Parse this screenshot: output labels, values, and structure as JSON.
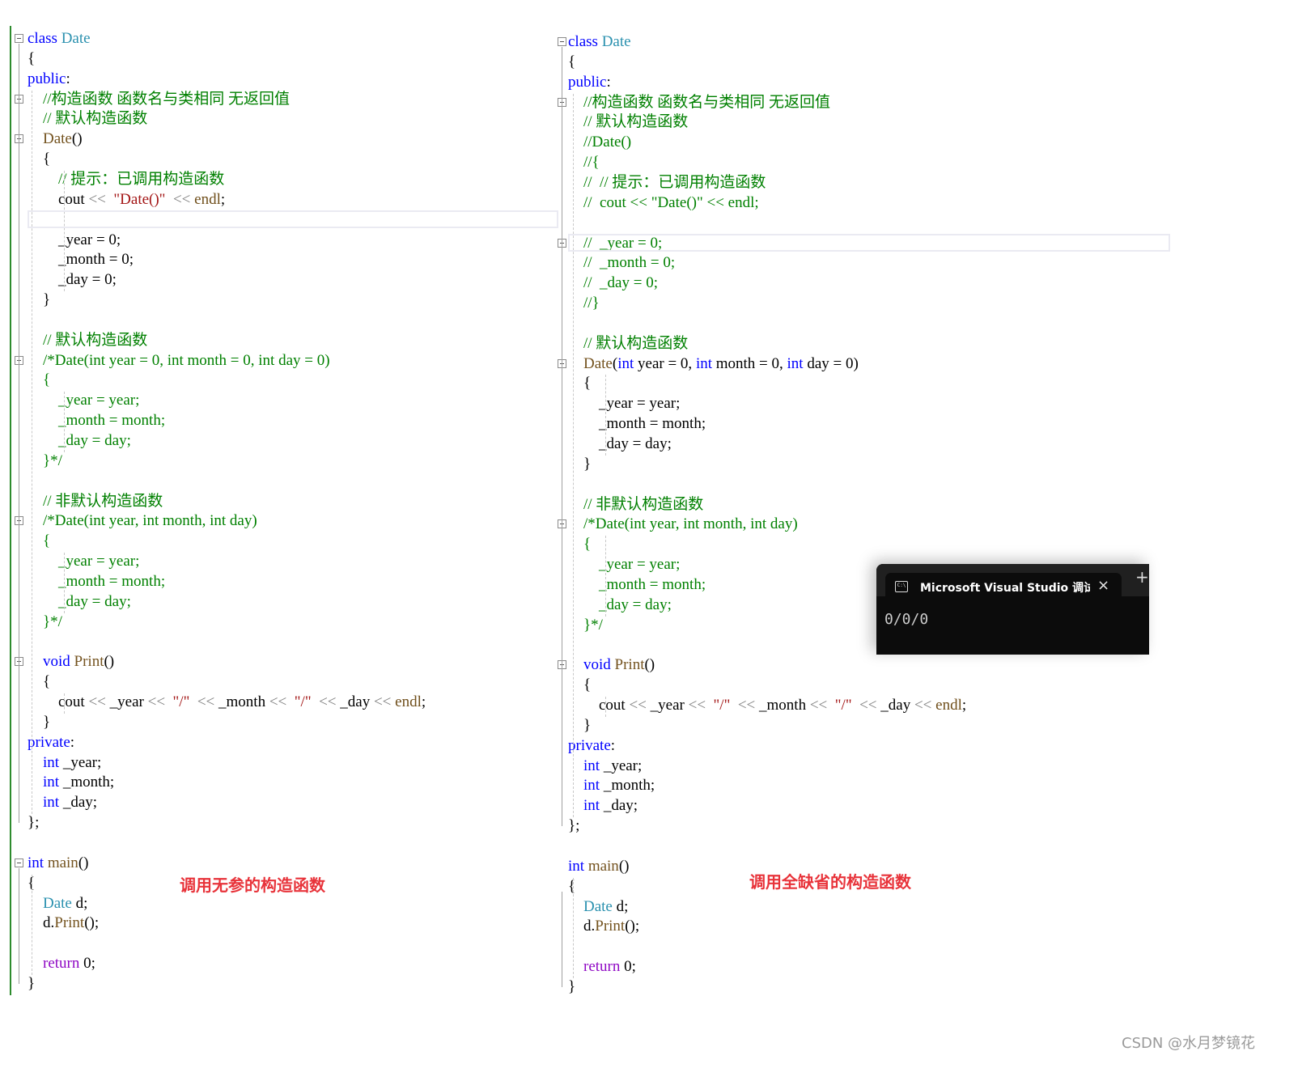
{
  "left_panel": {
    "caption": "调用无参的构造函数",
    "lines": [
      [
        [
          "kw",
          "class "
        ],
        [
          "ty",
          "Date"
        ]
      ],
      [
        [
          "",
          "{"
        ]
      ],
      [
        [
          "kw",
          "public"
        ],
        [
          "",
          ":"
        ]
      ],
      [
        [
          "",
          "    "
        ],
        [
          "cm",
          "//构造函数 函数名与类相同 无返回值"
        ]
      ],
      [
        [
          "",
          "    "
        ],
        [
          "cm",
          "// 默认构造函数"
        ]
      ],
      [
        [
          "",
          "    "
        ],
        [
          "fn",
          "Date"
        ],
        [
          "",
          "()"
        ]
      ],
      [
        [
          "",
          "    {"
        ]
      ],
      [
        [
          "",
          "        "
        ],
        [
          "cm",
          "// 提示：已调用构造函数"
        ]
      ],
      [
        [
          "",
          "        cout "
        ],
        [
          "op",
          "<<"
        ],
        [
          "",
          "  "
        ],
        [
          "st",
          "\"Date()\""
        ],
        [
          "",
          "  "
        ],
        [
          "op",
          "<<"
        ],
        [
          "ed",
          " endl"
        ],
        [
          "",
          ";"
        ]
      ],
      [
        [
          "",
          ""
        ]
      ],
      [
        [
          "",
          "        _year = 0;"
        ]
      ],
      [
        [
          "",
          "        _month = 0;"
        ]
      ],
      [
        [
          "",
          "        _day = 0;"
        ]
      ],
      [
        [
          "",
          "    }"
        ]
      ],
      [
        [
          "",
          ""
        ]
      ],
      [
        [
          "",
          "    "
        ],
        [
          "cm",
          "// 默认构造函数"
        ]
      ],
      [
        [
          "",
          "    "
        ],
        [
          "cm",
          "/*Date(int year = 0, int month = 0, int day = 0)"
        ]
      ],
      [
        [
          "",
          "    "
        ],
        [
          "cm",
          "{"
        ]
      ],
      [
        [
          "",
          "        "
        ],
        [
          "cm",
          "_year = year;"
        ]
      ],
      [
        [
          "",
          "        "
        ],
        [
          "cm",
          "_month = month;"
        ]
      ],
      [
        [
          "",
          "        "
        ],
        [
          "cm",
          "_day = day;"
        ]
      ],
      [
        [
          "",
          "    "
        ],
        [
          "cm",
          "}*/"
        ]
      ],
      [
        [
          "",
          ""
        ]
      ],
      [
        [
          "",
          "    "
        ],
        [
          "cm",
          "// 非默认构造函数"
        ]
      ],
      [
        [
          "",
          "    "
        ],
        [
          "cm",
          "/*Date(int year, int month, int day)"
        ]
      ],
      [
        [
          "",
          "    "
        ],
        [
          "cm",
          "{"
        ]
      ],
      [
        [
          "",
          "        "
        ],
        [
          "cm",
          "_year = year;"
        ]
      ],
      [
        [
          "",
          "        "
        ],
        [
          "cm",
          "_month = month;"
        ]
      ],
      [
        [
          "",
          "        "
        ],
        [
          "cm",
          "_day = day;"
        ]
      ],
      [
        [
          "",
          "    "
        ],
        [
          "cm",
          "}*/"
        ]
      ],
      [
        [
          "",
          ""
        ]
      ],
      [
        [
          "",
          "    "
        ],
        [
          "kw",
          "void "
        ],
        [
          "fn",
          "Print"
        ],
        [
          "",
          "()"
        ]
      ],
      [
        [
          "",
          "    {"
        ]
      ],
      [
        [
          "",
          "        cout "
        ],
        [
          "op",
          "<<"
        ],
        [
          "",
          " _year "
        ],
        [
          "op",
          "<<"
        ],
        [
          "",
          "  "
        ],
        [
          "st",
          "\"/\""
        ],
        [
          "",
          "  "
        ],
        [
          "op",
          "<<"
        ],
        [
          "",
          " _month "
        ],
        [
          "op",
          "<<"
        ],
        [
          "",
          "  "
        ],
        [
          "st",
          "\"/\""
        ],
        [
          "",
          "  "
        ],
        [
          "op",
          "<<"
        ],
        [
          "",
          " _day "
        ],
        [
          "op",
          "<<"
        ],
        [
          "ed",
          " endl"
        ],
        [
          "",
          ";"
        ]
      ],
      [
        [
          "",
          "    }"
        ]
      ],
      [
        [
          "kw",
          "private"
        ],
        [
          "",
          ":"
        ]
      ],
      [
        [
          "",
          "    "
        ],
        [
          "kw",
          "int"
        ],
        [
          "",
          " _year;"
        ]
      ],
      [
        [
          "",
          "    "
        ],
        [
          "kw",
          "int"
        ],
        [
          "",
          " _month;"
        ]
      ],
      [
        [
          "",
          "    "
        ],
        [
          "kw",
          "int"
        ],
        [
          "",
          " _day;"
        ]
      ],
      [
        [
          "",
          "};"
        ]
      ],
      [
        [
          "",
          ""
        ]
      ],
      [
        [
          "kw",
          "int "
        ],
        [
          "fn",
          "main"
        ],
        [
          "",
          "()"
        ]
      ],
      [
        [
          "",
          "{"
        ]
      ],
      [
        [
          "",
          "    "
        ],
        [
          "ty",
          "Date"
        ],
        [
          "",
          " d;"
        ]
      ],
      [
        [
          "",
          "    d."
        ],
        [
          "fn",
          "Print"
        ],
        [
          "",
          "();"
        ]
      ],
      [
        [
          "",
          ""
        ]
      ],
      [
        [
          "",
          "    "
        ],
        [
          "rt",
          "return"
        ],
        [
          "",
          " 0;"
        ]
      ],
      [
        [
          "",
          "}"
        ]
      ]
    ]
  },
  "right_panel": {
    "caption": "调用全缺省的构造函数",
    "lines": [
      [
        [
          "kw",
          "class "
        ],
        [
          "ty",
          "Date"
        ]
      ],
      [
        [
          "",
          "{"
        ]
      ],
      [
        [
          "kw",
          "public"
        ],
        [
          "",
          ":"
        ]
      ],
      [
        [
          "",
          "    "
        ],
        [
          "cm",
          "//构造函数 函数名与类相同 无返回值"
        ]
      ],
      [
        [
          "",
          "    "
        ],
        [
          "cm",
          "// 默认构造函数"
        ]
      ],
      [
        [
          "",
          "    "
        ],
        [
          "cm",
          "//Date()"
        ]
      ],
      [
        [
          "",
          "    "
        ],
        [
          "cm",
          "//{"
        ]
      ],
      [
        [
          "",
          "    "
        ],
        [
          "cm",
          "//  // 提示：已调用构造函数"
        ]
      ],
      [
        [
          "",
          "    "
        ],
        [
          "cm",
          "//  cout << \"Date()\" << endl;"
        ]
      ],
      [
        [
          "",
          ""
        ]
      ],
      [
        [
          "",
          "    "
        ],
        [
          "cm",
          "//  _year = 0;"
        ]
      ],
      [
        [
          "",
          "    "
        ],
        [
          "cm",
          "//  _month = 0;"
        ]
      ],
      [
        [
          "",
          "    "
        ],
        [
          "cm",
          "//  _day = 0;"
        ]
      ],
      [
        [
          "",
          "    "
        ],
        [
          "cm",
          "//}"
        ]
      ],
      [
        [
          "",
          ""
        ]
      ],
      [
        [
          "",
          "    "
        ],
        [
          "cm",
          "// 默认构造函数"
        ]
      ],
      [
        [
          "",
          "    "
        ],
        [
          "fn",
          "Date"
        ],
        [
          "",
          "("
        ],
        [
          "kw",
          "int"
        ],
        [
          "",
          " year = 0, "
        ],
        [
          "kw",
          "int"
        ],
        [
          "",
          " month = 0, "
        ],
        [
          "kw",
          "int"
        ],
        [
          "",
          " day = 0)"
        ]
      ],
      [
        [
          "",
          "    {"
        ]
      ],
      [
        [
          "",
          "        _year = year;"
        ]
      ],
      [
        [
          "",
          "        _month = month;"
        ]
      ],
      [
        [
          "",
          "        _day = day;"
        ]
      ],
      [
        [
          "",
          "    }"
        ]
      ],
      [
        [
          "",
          ""
        ]
      ],
      [
        [
          "",
          "    "
        ],
        [
          "cm",
          "// 非默认构造函数"
        ]
      ],
      [
        [
          "",
          "    "
        ],
        [
          "cm",
          "/*Date(int year, int month, int day)"
        ]
      ],
      [
        [
          "",
          "    "
        ],
        [
          "cm",
          "{"
        ]
      ],
      [
        [
          "",
          "        "
        ],
        [
          "cm",
          "_year = year;"
        ]
      ],
      [
        [
          "",
          "        "
        ],
        [
          "cm",
          "_month = month;"
        ]
      ],
      [
        [
          "",
          "        "
        ],
        [
          "cm",
          "_day = day;"
        ]
      ],
      [
        [
          "",
          "    "
        ],
        [
          "cm",
          "}*/"
        ]
      ],
      [
        [
          "",
          ""
        ]
      ],
      [
        [
          "",
          "    "
        ],
        [
          "kw",
          "void "
        ],
        [
          "fn",
          "Print"
        ],
        [
          "",
          "()"
        ]
      ],
      [
        [
          "",
          "    {"
        ]
      ],
      [
        [
          "",
          "        cout "
        ],
        [
          "op",
          "<<"
        ],
        [
          "",
          " _year "
        ],
        [
          "op",
          "<<"
        ],
        [
          "",
          "  "
        ],
        [
          "st",
          "\"/\""
        ],
        [
          "",
          "  "
        ],
        [
          "op",
          "<<"
        ],
        [
          "",
          " _month "
        ],
        [
          "op",
          "<<"
        ],
        [
          "",
          "  "
        ],
        [
          "st",
          "\"/\""
        ],
        [
          "",
          "  "
        ],
        [
          "op",
          "<<"
        ],
        [
          "",
          " _day "
        ],
        [
          "op",
          "<<"
        ],
        [
          "ed",
          " endl"
        ],
        [
          "",
          ";"
        ]
      ],
      [
        [
          "",
          "    }"
        ]
      ],
      [
        [
          "kw",
          "private"
        ],
        [
          "",
          ":"
        ]
      ],
      [
        [
          "",
          "    "
        ],
        [
          "kw",
          "int"
        ],
        [
          "",
          " _year;"
        ]
      ],
      [
        [
          "",
          "    "
        ],
        [
          "kw",
          "int"
        ],
        [
          "",
          " _month;"
        ]
      ],
      [
        [
          "",
          "    "
        ],
        [
          "kw",
          "int"
        ],
        [
          "",
          " _day;"
        ]
      ],
      [
        [
          "",
          "};"
        ]
      ],
      [
        [
          "",
          ""
        ]
      ],
      [
        [
          "kw",
          "int "
        ],
        [
          "fn",
          "main"
        ],
        [
          "",
          "()"
        ]
      ],
      [
        [
          "",
          "{"
        ]
      ],
      [
        [
          "",
          "    "
        ],
        [
          "ty",
          "Date"
        ],
        [
          "",
          " d;"
        ]
      ],
      [
        [
          "",
          "    d."
        ],
        [
          "fn",
          "Print"
        ],
        [
          "",
          "();"
        ]
      ],
      [
        [
          "",
          ""
        ]
      ],
      [
        [
          "",
          "    "
        ],
        [
          "rt",
          "return"
        ],
        [
          "",
          " 0;"
        ]
      ],
      [
        [
          "",
          "}"
        ]
      ]
    ]
  },
  "console": {
    "title": "Microsoft Visual Studio 调试控",
    "icon": "terminal-icon",
    "close_label": "×",
    "new_tab_label": "+",
    "output": "0/0/0"
  },
  "watermark": "CSDN @水月梦镜花",
  "colors": {
    "keyword": "#0000ff",
    "type": "#2b91af",
    "comment": "#008000",
    "string": "#a31515",
    "caption": "#e8333a",
    "console_bg": "#0c0c0c"
  }
}
